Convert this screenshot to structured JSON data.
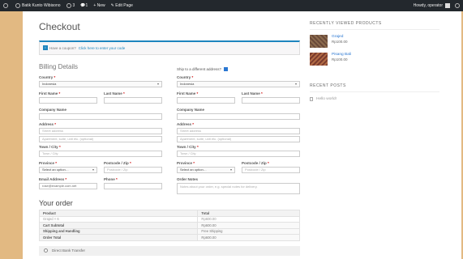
{
  "admin_bar": {
    "site_name": "Batik Kunto Wibisono",
    "updates_count": "3",
    "comments_count": "1",
    "new_label": "New",
    "edit_label": "Edit Page",
    "greeting": "Howdy, operator"
  },
  "page": {
    "title": "Checkout",
    "coupon_text": "Have a coupon?",
    "coupon_link": "Click here to enter your code"
  },
  "billing": {
    "heading": "Billing Details",
    "country_label": "Country",
    "country_value": "Indonesia",
    "first_name_label": "First Name",
    "last_name_label": "Last Name",
    "company_label": "Company Name",
    "address_label": "Address",
    "address_placeholder": "Street address",
    "address2_placeholder": "Apartment, suite, unit etc. (optional)",
    "city_label": "Town / City",
    "city_placeholder": "Town / City",
    "province_label": "Province",
    "province_value": "Select an option…",
    "postcode_label": "Postcode / Zip",
    "postcode_placeholder": "Postcode / Zip",
    "email_label": "Email Address",
    "email_value": "rose@example.com.net",
    "phone_label": "Phone"
  },
  "shipping": {
    "heading": "Ship to a different address?",
    "country_label": "Country",
    "country_value": "Indonesia",
    "first_name_label": "First Name",
    "last_name_label": "Last Name",
    "company_label": "Company Name",
    "address_label": "Address",
    "address_placeholder": "Street address",
    "address2_placeholder": "Apartment, suite, unit etc. (optional)",
    "city_label": "Town / City",
    "city_placeholder": "Town / City",
    "province_label": "Province",
    "province_value": "Select an option…",
    "postcode_label": "Postcode / Zip",
    "postcode_placeholder": "Postcode / Zip",
    "notes_label": "Order Notes",
    "notes_placeholder": "Notes about your order, e.g. special notes for delivery."
  },
  "order": {
    "heading": "Your order",
    "col_product": "Product",
    "col_total": "Total",
    "items": [
      {
        "product": "Grajed × 6",
        "total": "Rp600.00"
      }
    ],
    "subtotal_label": "Cart Subtotal",
    "subtotal_value": "Rp600.00",
    "shipping_label": "Shipping and Handling",
    "shipping_value": "Free Shipping",
    "total_label": "Order Total",
    "total_value": "Rp600.00"
  },
  "payment": {
    "method": "Direct Bank Transfer"
  },
  "sidebar": {
    "recent_products_title": "RECENTLY VIEWED PRODUCTS",
    "products": [
      {
        "name": "Grajed",
        "price": "Rp100.00"
      },
      {
        "name": "Pisang Bali",
        "price": "Rp100.00"
      }
    ],
    "recent_posts_title": "RECENT POSTS",
    "posts": [
      "Hello world!"
    ]
  }
}
